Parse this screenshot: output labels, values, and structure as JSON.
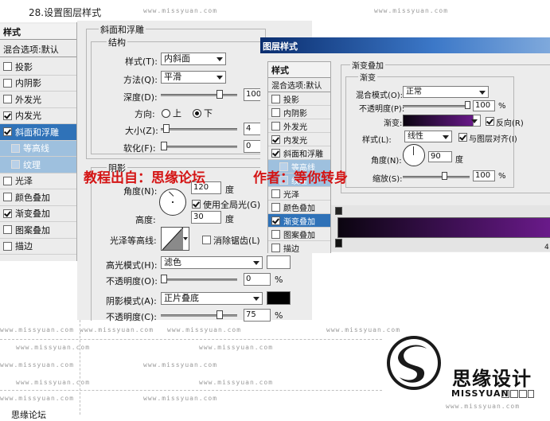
{
  "caption": "28.设置图层样式",
  "watermarks": {
    "text": "www.missyuan.com"
  },
  "overlay": {
    "source_text": "教程出自：思缘论坛",
    "author_text": "作者：等你转身"
  },
  "logo": {
    "name_cn": "思缘设计",
    "name_en": "MISSYUAN"
  },
  "bottom_cut_text": "思缘论坛",
  "left_panel": {
    "title": "样式",
    "blend_default": "混合选项:默认",
    "items": [
      {
        "label": "投影",
        "checked": false
      },
      {
        "label": "内阴影",
        "checked": false
      },
      {
        "label": "外发光",
        "checked": false
      },
      {
        "label": "内发光",
        "checked": true
      },
      {
        "label": "斜面和浮雕",
        "checked": true
      },
      {
        "label": "等高线",
        "checked": false
      },
      {
        "label": "纹理",
        "checked": false
      },
      {
        "label": "光泽",
        "checked": false
      },
      {
        "label": "颜色叠加",
        "checked": false
      },
      {
        "label": "渐变叠加",
        "checked": true
      },
      {
        "label": "图案叠加",
        "checked": false
      },
      {
        "label": "描边",
        "checked": false
      }
    ]
  },
  "bevel": {
    "section_title": "斜面和浮雕",
    "structure_title": "结构",
    "style_label": "样式(T):",
    "style_value": "内斜面",
    "method_label": "方法(Q):",
    "method_value": "平滑",
    "depth_label": "深度(D):",
    "depth_value": "100",
    "direction_label": "方向:",
    "direction_up": "上",
    "direction_down": "下",
    "size_label": "大小(Z):",
    "size_value": "4",
    "soften_label": "软化(F):",
    "soften_value": "0",
    "shading_title": "阴影",
    "angle_label": "角度(N):",
    "angle_value": "120",
    "angle_unit": "度",
    "global_light_label": "使用全局光(G)",
    "altitude_label": "高度:",
    "altitude_value": "30",
    "altitude_unit": "度",
    "gloss_contour_label": "光泽等高线:",
    "antialias_label": "消除锯齿(L)",
    "highlight_mode_label": "高光模式(H):",
    "highlight_mode_value": "滤色",
    "highlight_color": "#ffffff",
    "opacity_label": "不透明度(O):",
    "highlight_opacity": "0",
    "percent": "%",
    "shadow_mode_label": "阴影模式(A):",
    "shadow_mode_value": "正片叠底",
    "shadow_color": "#000000",
    "shadow_opacity_label": "不透明度(C):",
    "shadow_opacity": "75"
  },
  "dialog2": {
    "title": "图层样式",
    "styles_title": "样式",
    "blend_default": "混合选项:默认",
    "items": [
      {
        "label": "投影",
        "checked": false
      },
      {
        "label": "内阴影",
        "checked": false
      },
      {
        "label": "外发光",
        "checked": false
      },
      {
        "label": "内发光",
        "checked": true
      },
      {
        "label": "斜面和浮雕",
        "checked": true
      },
      {
        "label": "等高线",
        "checked": false
      },
      {
        "label": "纹理",
        "checked": false
      },
      {
        "label": "光泽",
        "checked": false
      },
      {
        "label": "颜色叠加",
        "checked": false
      },
      {
        "label": "渐变叠加",
        "checked": true
      },
      {
        "label": "图案叠加",
        "checked": false
      },
      {
        "label": "描边",
        "checked": false
      }
    ],
    "gradient_overlay_title": "渐变叠加",
    "gradient_title": "渐变",
    "blend_mode_label": "混合模式(O):",
    "blend_mode_value": "正常",
    "opacity_label": "不透明度(P):",
    "opacity_value": "100",
    "percent": "%",
    "gradient_label": "渐变:",
    "reverse_label": "反向(R)",
    "style_label": "样式(L):",
    "style_value": "线性",
    "align_label": "与图层对齐(I)",
    "angle_label": "角度(N):",
    "angle_value": "90",
    "angle_unit": "度",
    "scale_label": "缩放(S):",
    "scale_value": "100",
    "gradient_colors": [
      "#0b0510",
      "#3a0f4f",
      "#6a1a8a"
    ],
    "editor_right_text": "4"
  }
}
